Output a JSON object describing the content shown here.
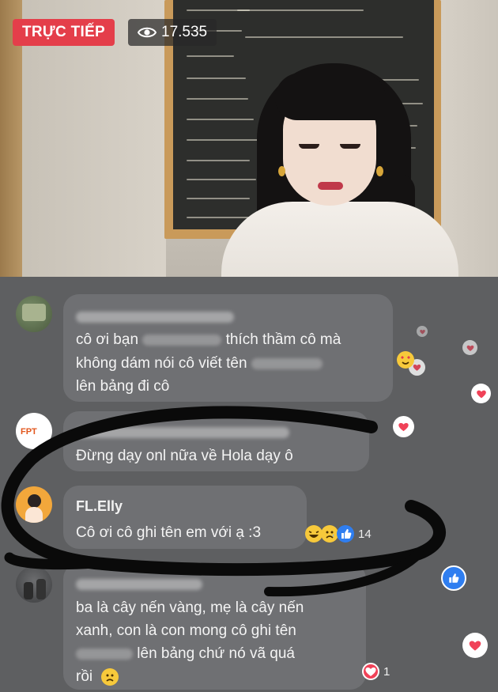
{
  "stream": {
    "live_label": "TRỰC TIẾP",
    "viewer_count": "17.535"
  },
  "comments": [
    {
      "lines": [
        "cô ơi bạn",
        "thích thầm cô mà",
        "không dám nói cô viết tên",
        "lên bảng đi cô"
      ]
    },
    {
      "lines": [
        "Đừng dạy onl nữa về Hola dạy",
        "ô"
      ]
    },
    {
      "name": "FL.Elly",
      "lines": [
        "Cô ơi cô ghi tên em với ạ :3"
      ],
      "reaction_count": "14"
    },
    {
      "lines": [
        "ba là cây nến vàng, mẹ là cây nến",
        "xanh, con là con mong cô ghi tên",
        "lên bảng chứ nó vã quá",
        "rồi"
      ],
      "reaction_count": "1"
    }
  ],
  "colors": {
    "live_red": "#e43e4a",
    "heart_red": "#f04258",
    "like_blue": "#2f7ef0",
    "bubble": "#6f7073",
    "background": "#5e5f61"
  },
  "icons": [
    "eye-icon",
    "heart-icon",
    "like-icon",
    "laugh-emoji-icon",
    "sad-emoji-icon"
  ]
}
